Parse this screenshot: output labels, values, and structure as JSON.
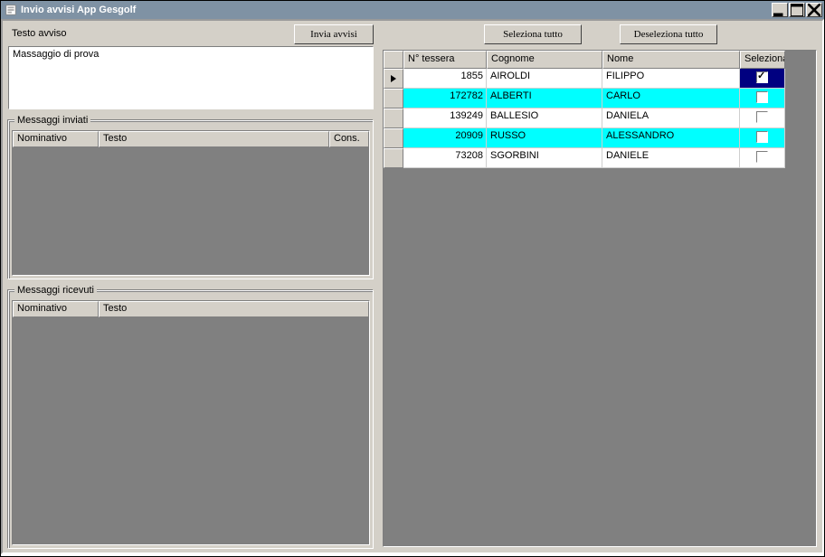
{
  "window": {
    "title": "Invio avvisi App Gesgolf"
  },
  "left": {
    "testo_avviso_label": "Testo avviso",
    "invia_avvisi_label": "Invia avvisi",
    "message_text": "Massaggio di prova",
    "sent_legend": "Messaggi inviati",
    "sent_headers": {
      "nominativo": "Nominativo",
      "testo": "Testo",
      "cons": "Cons."
    },
    "received_legend": "Messaggi ricevuti",
    "received_headers": {
      "nominativo": "Nominativo",
      "testo": "Testo"
    }
  },
  "right": {
    "select_all_label": "Seleziona tutto",
    "deselect_all_label": "Deseleziona tutto",
    "headers": {
      "tessera": "N° tessera",
      "cognome": "Cognome",
      "nome": "Nome",
      "seleziona": "Seleziona"
    },
    "rows": [
      {
        "tessera": "1855",
        "cognome": "AIROLDI",
        "nome": "FILIPPO",
        "selected": true,
        "highlight": false,
        "current": true
      },
      {
        "tessera": "172782",
        "cognome": "ALBERTI",
        "nome": "CARLO",
        "selected": false,
        "highlight": true,
        "current": false
      },
      {
        "tessera": "139249",
        "cognome": "BALLESIO",
        "nome": "DANIELA",
        "selected": false,
        "highlight": false,
        "current": false
      },
      {
        "tessera": "20909",
        "cognome": "RUSSO",
        "nome": "ALESSANDRO",
        "selected": false,
        "highlight": true,
        "current": false
      },
      {
        "tessera": "73208",
        "cognome": "SGORBINI",
        "nome": "DANIELE",
        "selected": false,
        "highlight": false,
        "current": false
      }
    ]
  }
}
